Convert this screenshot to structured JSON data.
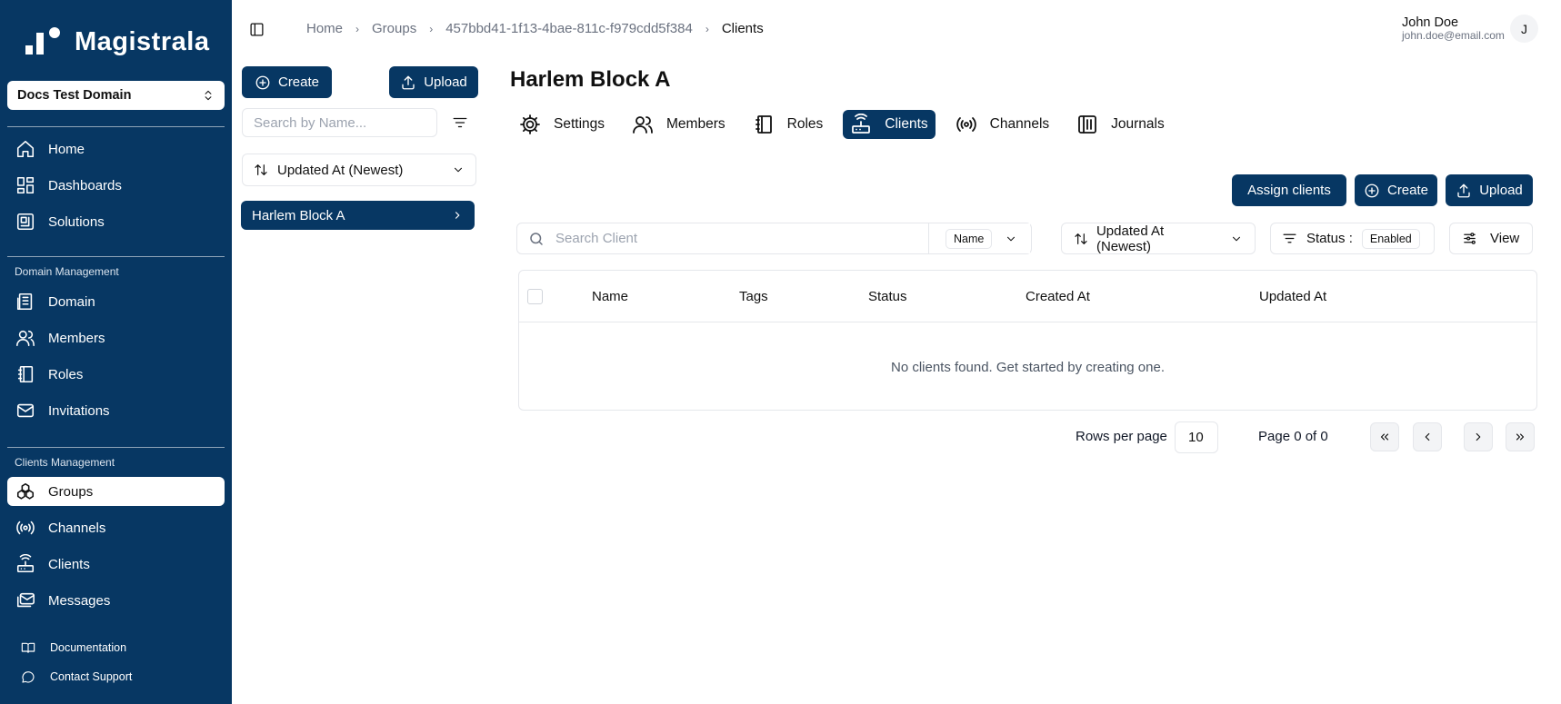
{
  "app": {
    "name": "Magistrala"
  },
  "sidebar": {
    "domain": "Docs Test Domain",
    "main_items": [
      {
        "label": "Home",
        "icon": "home-icon"
      },
      {
        "label": "Dashboards",
        "icon": "dashboard-icon"
      },
      {
        "label": "Solutions",
        "icon": "solutions-icon"
      }
    ],
    "domain_section": "Domain Management",
    "domain_items": [
      {
        "label": "Domain",
        "icon": "domain-icon"
      },
      {
        "label": "Members",
        "icon": "members-icon"
      },
      {
        "label": "Roles",
        "icon": "roles-icon"
      },
      {
        "label": "Invitations",
        "icon": "mail-icon"
      }
    ],
    "clients_section": "Clients Management",
    "clients_items": [
      {
        "label": "Groups",
        "icon": "groups-icon",
        "active": true
      },
      {
        "label": "Channels",
        "icon": "channels-icon"
      },
      {
        "label": "Clients",
        "icon": "router-icon"
      },
      {
        "label": "Messages",
        "icon": "messages-icon"
      }
    ],
    "footer_items": [
      {
        "label": "Documentation",
        "icon": "book-icon"
      },
      {
        "label": "Contact Support",
        "icon": "chat-icon"
      }
    ]
  },
  "breadcrumb": [
    "Home",
    "Groups",
    "457bbd41-1f13-4bae-811c-f979cdd5f384",
    "Clients"
  ],
  "user": {
    "name": "John Doe",
    "email": "john.doe@email.com",
    "initial": "J"
  },
  "groups_panel": {
    "create_label": "Create",
    "upload_label": "Upload",
    "search_placeholder": "Search by Name...",
    "sort_label": "Updated At (Newest)",
    "items": [
      "Harlem Block A"
    ]
  },
  "group": {
    "title": "Harlem Block A",
    "tabs": [
      {
        "label": "Settings",
        "icon": "gear-icon"
      },
      {
        "label": "Members",
        "icon": "members-icon"
      },
      {
        "label": "Roles",
        "icon": "roles-icon"
      },
      {
        "label": "Clients",
        "icon": "router-icon",
        "active": true
      },
      {
        "label": "Channels",
        "icon": "channels-icon"
      },
      {
        "label": "Journals",
        "icon": "journals-icon"
      }
    ]
  },
  "clients": {
    "assign_label": "Assign clients",
    "create_label": "Create",
    "upload_label": "Upload",
    "search_placeholder": "Search Client",
    "search_field": "Name",
    "sort_label": "Updated At (Newest)",
    "status_label": "Status :",
    "status_value": "Enabled",
    "view_label": "View",
    "columns": [
      "Name",
      "Tags",
      "Status",
      "Created At",
      "Updated At"
    ],
    "empty_message": "No clients found. Get started by creating one.",
    "rows_per_page_label": "Rows per page",
    "rows_per_page": "10",
    "page_info": "Page 0 of 0"
  },
  "colors": {
    "brand": "#073763",
    "border": "#e5e7eb"
  }
}
